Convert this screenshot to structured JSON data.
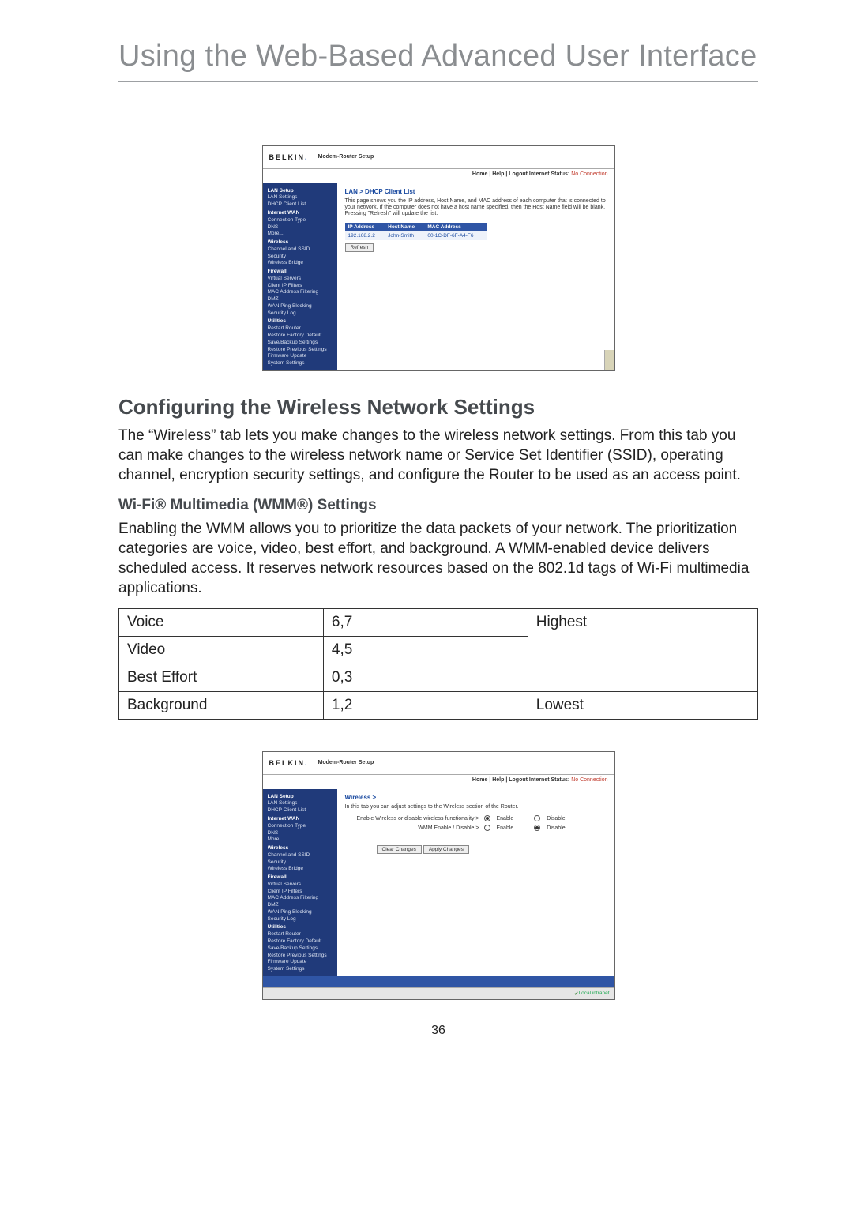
{
  "page_title": "Using the Web-Based Advanced User Interface",
  "page_number": "36",
  "section_heading": "Configuring the Wireless Network Settings",
  "section_paragraph": "The “Wireless” tab lets you make changes to the wireless network settings. From this tab you can make changes to the wireless network name or Service Set Identifier (SSID), operating channel, encryption security settings, and configure the Router to be used as an access point.",
  "sub_heading": "Wi-Fi® Multimedia (WMM®) Settings",
  "sub_paragraph": "Enabling the WMM allows you to prioritize the data packets of your network. The prioritization categories are voice, video, best effort, and background. A WMM-enabled device delivers scheduled access. It reserves network resources based on the 802.1d tags of Wi-Fi multimedia applications.",
  "priority_table": {
    "rows": [
      {
        "name": "Voice",
        "tags": "6,7",
        "priority": "Highest"
      },
      {
        "name": "Video",
        "tags": "4,5",
        "priority": ""
      },
      {
        "name": "Best Effort",
        "tags": "0,3",
        "priority": ""
      },
      {
        "name": "Background",
        "tags": "1,2",
        "priority": "Lowest"
      }
    ]
  },
  "screenshot_common": {
    "brand": "BELKIN",
    "setup_title": "Modem-Router Setup",
    "header_links": "Home | Help | Logout   Internet Status:",
    "no_connection": "No Connection",
    "nav": {
      "lan_setup": "LAN Setup",
      "lan_settings": "LAN Settings",
      "dhcp_client_list": "DHCP Client List",
      "internet_wan": "Internet WAN",
      "connection_type": "Connection Type",
      "dns": "DNS",
      "more": "More...",
      "wireless": "Wireless",
      "channel_ssid": "Channel and SSID",
      "security": "Security",
      "wireless_bridge": "Wireless Bridge",
      "firewall": "Firewall",
      "virtual_servers": "Virtual Servers",
      "client_ip_filters": "Client IP Filters",
      "mac_filtering": "MAC Address Filtering",
      "dmz": "DMZ",
      "wan_ping": "WAN Ping Blocking",
      "security_log": "Security Log",
      "utilities": "Utilities",
      "restart_router": "Restart Router",
      "restore_factory": "Restore Factory Default",
      "save_backup": "Save/Backup Settings",
      "restore_prev": "Restore Previous Settings",
      "firmware_update": "Firmware Update",
      "system_settings": "System Settings"
    }
  },
  "screenshot1": {
    "crumb": "LAN > DHCP Client List",
    "description": "This page shows you the IP address, Host Name, and MAC address of each computer that is connected to your network. If the computer does not have a host name specified, then the Host Name field will be blank. Pressing \"Refresh\" will update the list.",
    "table": {
      "headers": {
        "ip": "IP Address",
        "host": "Host Name",
        "mac": "MAC Address"
      },
      "row": {
        "ip": "192.168.2.2",
        "host": "John-Smith",
        "mac": "00-1C-DF-6F-A4-F6"
      }
    },
    "refresh_button": "Refresh"
  },
  "screenshot2": {
    "crumb": "Wireless >",
    "description": "In this tab you can adjust settings to the Wireless section of the Router.",
    "line1_label": "Enable Wireless or disable wireless functionality >",
    "line2_label": "WMM Enable / Disable >",
    "opt_enable": "Enable",
    "opt_disable": "Disable",
    "clear_btn": "Clear Changes",
    "apply_btn": "Apply Changes",
    "status_text": "Local intranet"
  }
}
